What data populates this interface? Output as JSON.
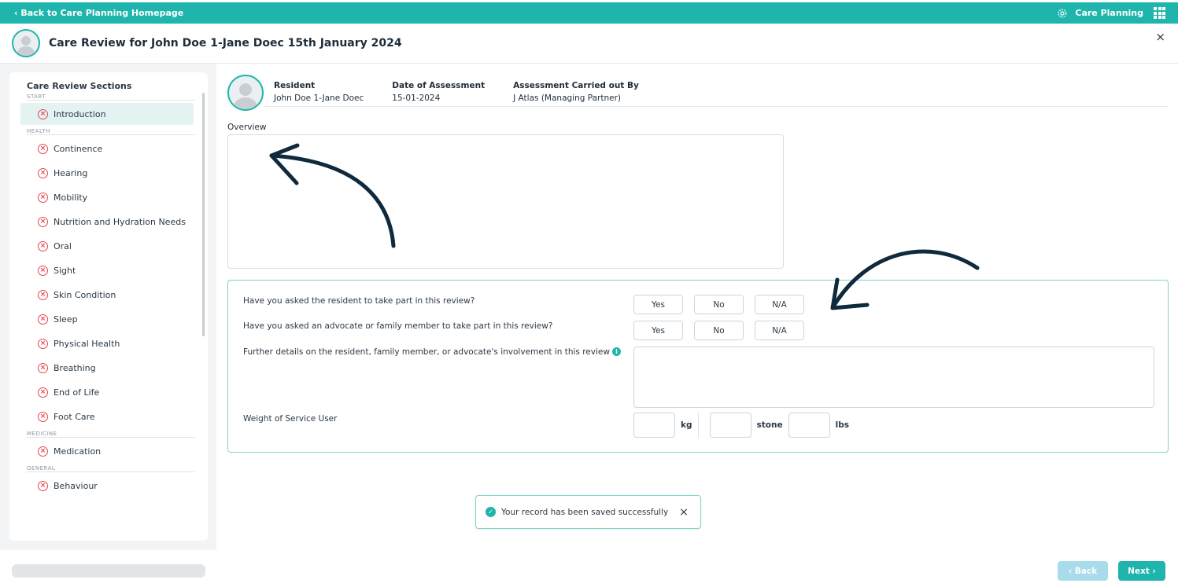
{
  "topbar": {
    "back_link": "‹ Back to Care Planning Homepage",
    "app_name": "Care Planning"
  },
  "header": {
    "title": "Care Review for John Doe 1-Jane Doec 15th January 2024",
    "close": "×"
  },
  "sidebar": {
    "title": "Care Review Sections",
    "groups": [
      {
        "label": "START",
        "items": [
          "Introduction"
        ]
      },
      {
        "label": "HEALTH",
        "items": [
          "Continence",
          "Hearing",
          "Mobility",
          "Nutrition and Hydration Needs",
          "Oral",
          "Sight",
          "Skin Condition",
          "Sleep",
          "Physical Health",
          "Breathing",
          "End of Life",
          "Foot Care"
        ]
      },
      {
        "label": "MEDICINE",
        "items": [
          "Medication"
        ]
      },
      {
        "label": "GENERAL",
        "items": [
          "Behaviour"
        ]
      }
    ]
  },
  "resident": {
    "resident_label": "Resident",
    "resident_value": "John Doe 1-Jane Doec",
    "date_label": "Date of Assessment",
    "date_value": "15-01-2024",
    "by_label": "Assessment Carried out By",
    "by_value": "J Atlas (Managing Partner)"
  },
  "overview": {
    "label": "Overview"
  },
  "questions": {
    "q1": "Have you asked the resident to take part in this review?",
    "q2": "Have you asked an advocate or family member to take part in this review?",
    "q3": "Further details on the resident, family member, or advocate's involvement in this review",
    "q4": "Weight of Service User",
    "options": {
      "yes": "Yes",
      "no": "No",
      "na": "N/A"
    },
    "units": {
      "kg": "kg",
      "stone": "stone",
      "lbs": "lbs"
    }
  },
  "toast": {
    "message": "Your record has been saved successfully"
  },
  "footer": {
    "back": "‹ Back",
    "next": "Next ›"
  },
  "colors": {
    "accent": "#1fb5ac",
    "error": "#e5484d",
    "annotation": "#0f2a3d"
  }
}
